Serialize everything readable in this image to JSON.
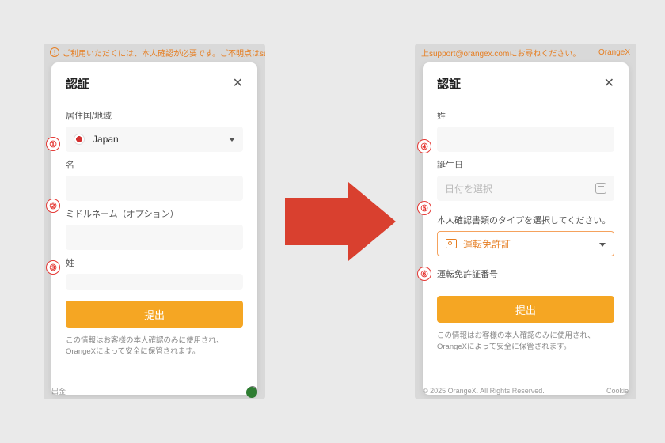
{
  "left": {
    "topbar": "ご利用いただくには、本人確認が必要です。ご不明点はsuppo",
    "modal_title": "認証",
    "country_label": "居住国/地域",
    "country_value": "Japan",
    "firstname_label": "名",
    "middlename_label": "ミドルネーム（オプション）",
    "lastname_label": "姓",
    "submit": "提出",
    "disclaimer": "この情報はお客様の本人確認のみに使用され、OrangeXによって安全に保管されます。",
    "bottom_left": "出金"
  },
  "right": {
    "topbar": "上support@orangex.comにお尋ねください。",
    "brand": "OrangeX",
    "modal_title": "認証",
    "lastname_label": "姓",
    "birthday_label": "誕生日",
    "birthday_placeholder": "日付を選択",
    "doctype_label": "本人確認書類のタイプを選択してください。",
    "doctype_value": "運転免許証",
    "docnum_label": "運転免許証番号",
    "submit": "提出",
    "disclaimer": "この情報はお客様の本人確認のみに使用され、OrangeXによって安全に保管されます。",
    "copyright": "© 2025 OrangeX. All Rights Reserved.",
    "cookie": "Cookie"
  },
  "badges": {
    "b1": "①",
    "b2": "②",
    "b3": "③",
    "b4": "④",
    "b5": "⑤",
    "b6": "⑥"
  }
}
